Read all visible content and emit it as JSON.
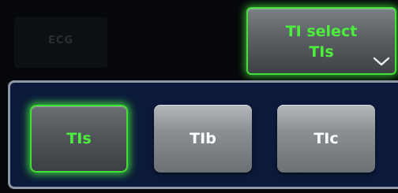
{
  "header": {
    "faint_label": "ECG",
    "ti_select": {
      "line1": "TI select",
      "line2": "TIs",
      "icon": "chevron-down-icon"
    }
  },
  "panel": {
    "options": [
      {
        "label": "TIs",
        "selected": true
      },
      {
        "label": "TIb",
        "selected": false
      },
      {
        "label": "TIc",
        "selected": false
      }
    ]
  },
  "colors": {
    "accent_green": "#4cf03c",
    "panel_blue": "#0b1a3a",
    "panel_border": "#8f96a6"
  }
}
